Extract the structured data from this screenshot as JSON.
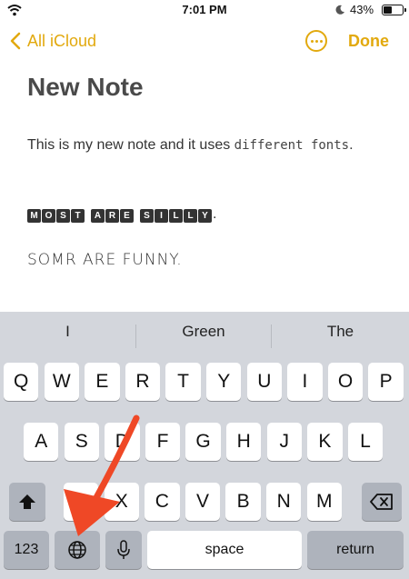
{
  "status_bar": {
    "time": "7:01 PM",
    "battery_percent": "43%",
    "battery_level": 0.43,
    "icons": [
      "wifi-icon",
      "moon-icon",
      "battery-icon"
    ]
  },
  "nav": {
    "back_label": "All iCloud",
    "more_icon": "ellipsis-circle-icon",
    "done_label": "Done",
    "accent_color": "#e2a90e"
  },
  "note": {
    "title": "New Note",
    "line1_normal": "This is my new note and it uses ",
    "line1_mono": "different fonts",
    "line1_end": ".",
    "line2_words": [
      "MOST",
      "ARE",
      "SILLY"
    ],
    "line2_end": ".",
    "line3": "SOMR ARE FUNNY."
  },
  "keyboard": {
    "suggestions": [
      "I",
      "Green",
      "The"
    ],
    "row1": [
      "Q",
      "W",
      "E",
      "R",
      "T",
      "Y",
      "U",
      "I",
      "O",
      "P"
    ],
    "row2": [
      "A",
      "S",
      "D",
      "F",
      "G",
      "H",
      "J",
      "K",
      "L"
    ],
    "row3": [
      "Z",
      "X",
      "C",
      "V",
      "B",
      "N",
      "M"
    ],
    "numbers_label": "123",
    "space_label": "space",
    "return_label": "return",
    "icons": [
      "shift-icon",
      "backspace-icon",
      "globe-icon",
      "microphone-icon"
    ]
  },
  "annotation": {
    "arrow_color": "#ef4826"
  }
}
